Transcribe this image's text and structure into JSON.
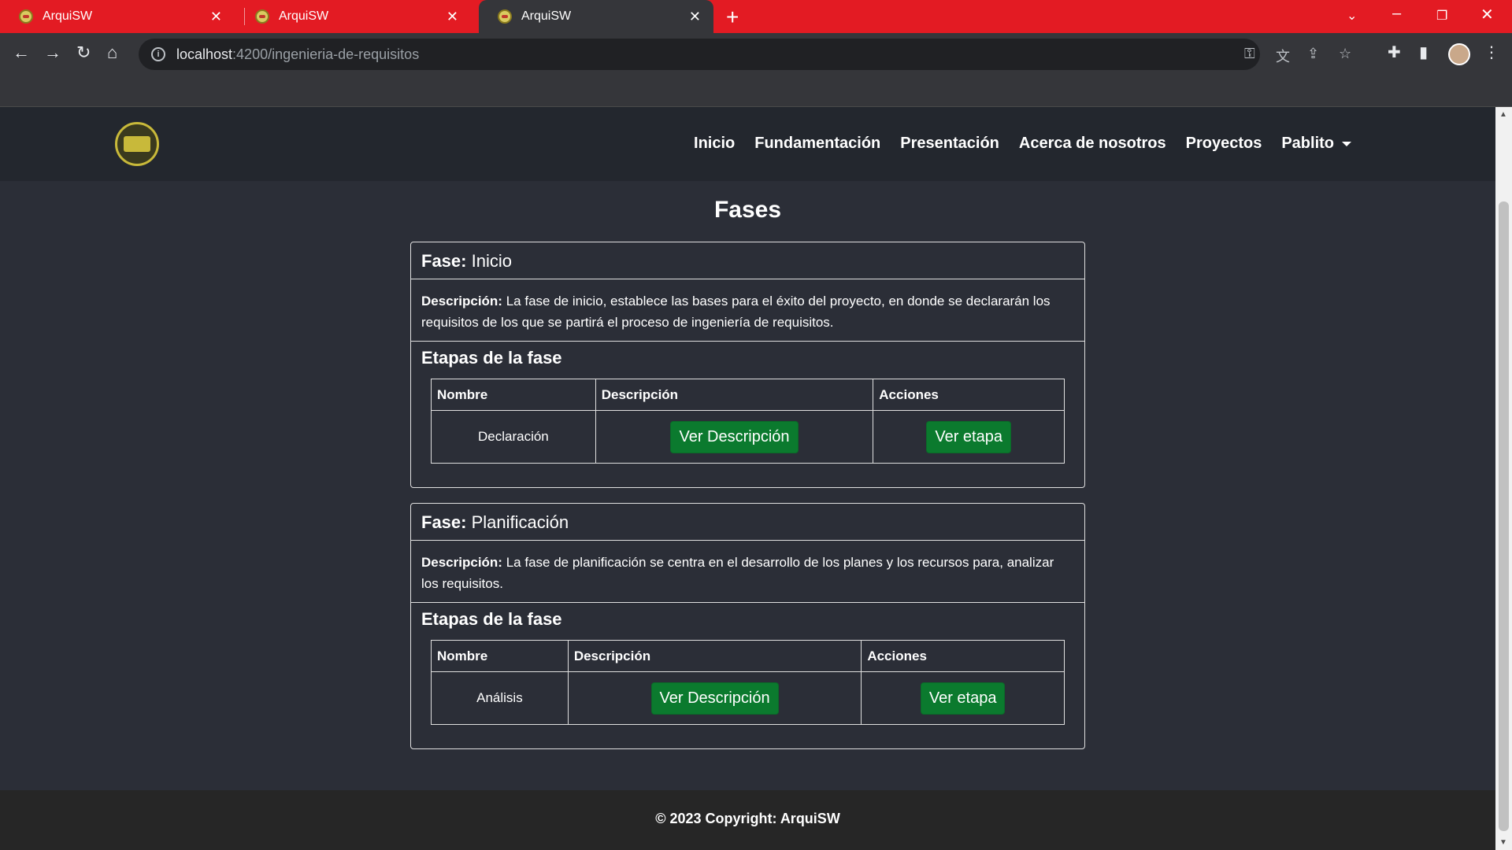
{
  "browser": {
    "tabs": [
      {
        "title": "ArquiSW"
      },
      {
        "title": "ArquiSW"
      },
      {
        "title": "ArquiSW"
      }
    ],
    "url_host": "localhost",
    "url_path": ":4200/ingenieria-de-requisitos",
    "tabbar_color": "#e31b23"
  },
  "navbar": {
    "links": [
      "Inicio",
      "Fundamentación",
      "Presentación",
      "Acerca de nosotros",
      "Proyectos"
    ],
    "user": "Pablito"
  },
  "page_title": "Fases",
  "phases": [
    {
      "label": "Fase:",
      "name": "Inicio",
      "desc_label": "Descripción:",
      "desc": "La fase de inicio, establece las bases para el éxito del proyecto, en donde se declararán los requisitos de los que se partirá el proceso de ingeniería de requisitos.",
      "stages_title": "Etapas de la fase",
      "columns": [
        "Nombre",
        "Descripción",
        "Acciones"
      ],
      "rows": [
        {
          "name": "Declaración",
          "desc_button": "Ver Descripción",
          "action_button": "Ver etapa"
        }
      ]
    },
    {
      "label": "Fase:",
      "name": "Planificación",
      "desc_label": "Descripción:",
      "desc": "La fase de planificación se centra en el desarrollo de los planes y los recursos para, analizar los requisitos.",
      "stages_title": "Etapas de la fase",
      "columns": [
        "Nombre",
        "Descripción",
        "Acciones"
      ],
      "rows": [
        {
          "name": "Análisis",
          "desc_button": "Ver Descripción",
          "action_button": "Ver etapa"
        }
      ]
    }
  ],
  "footer": "© 2023 Copyright: ArquiSW",
  "colors": {
    "button_green": "#0b7a2e",
    "page_bg": "#2b2e37"
  }
}
